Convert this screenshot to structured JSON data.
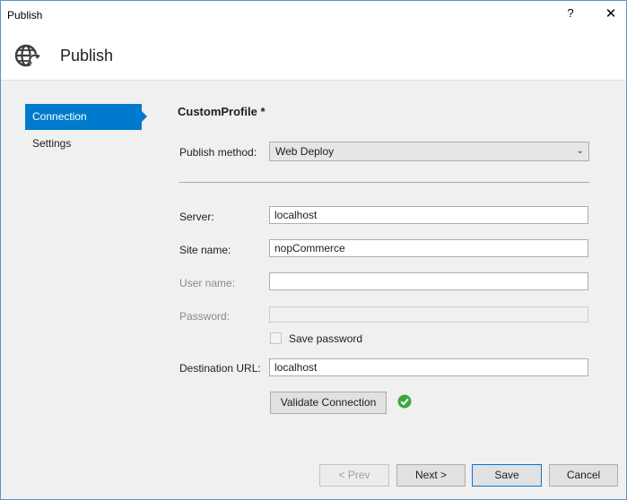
{
  "window": {
    "title": "Publish",
    "help_label": "?",
    "close_label": "✕"
  },
  "header": {
    "title": "Publish",
    "icon": "globe-publish-icon"
  },
  "nav": {
    "items": [
      {
        "label": "Connection",
        "active": true
      },
      {
        "label": "Settings",
        "active": false
      }
    ]
  },
  "profile": {
    "name": "CustomProfile *"
  },
  "form": {
    "publish_method": {
      "label": "Publish method:",
      "value": "Web Deploy"
    },
    "server": {
      "label": "Server:",
      "value": "localhost"
    },
    "site_name": {
      "label": "Site name:",
      "value": "nopCommerce"
    },
    "user_name": {
      "label": "User name:",
      "value": ""
    },
    "password": {
      "label": "Password:",
      "value": ""
    },
    "save_password": {
      "label": "Save password",
      "checked": false
    },
    "destination_url": {
      "label": "Destination URL:",
      "value": "localhost"
    },
    "validate_button": "Validate Connection",
    "validation_status": "success"
  },
  "footer": {
    "prev": "< Prev",
    "next": "Next >",
    "save": "Save",
    "cancel": "Cancel"
  },
  "colors": {
    "accent": "#007acc",
    "success": "#3aa93a"
  }
}
